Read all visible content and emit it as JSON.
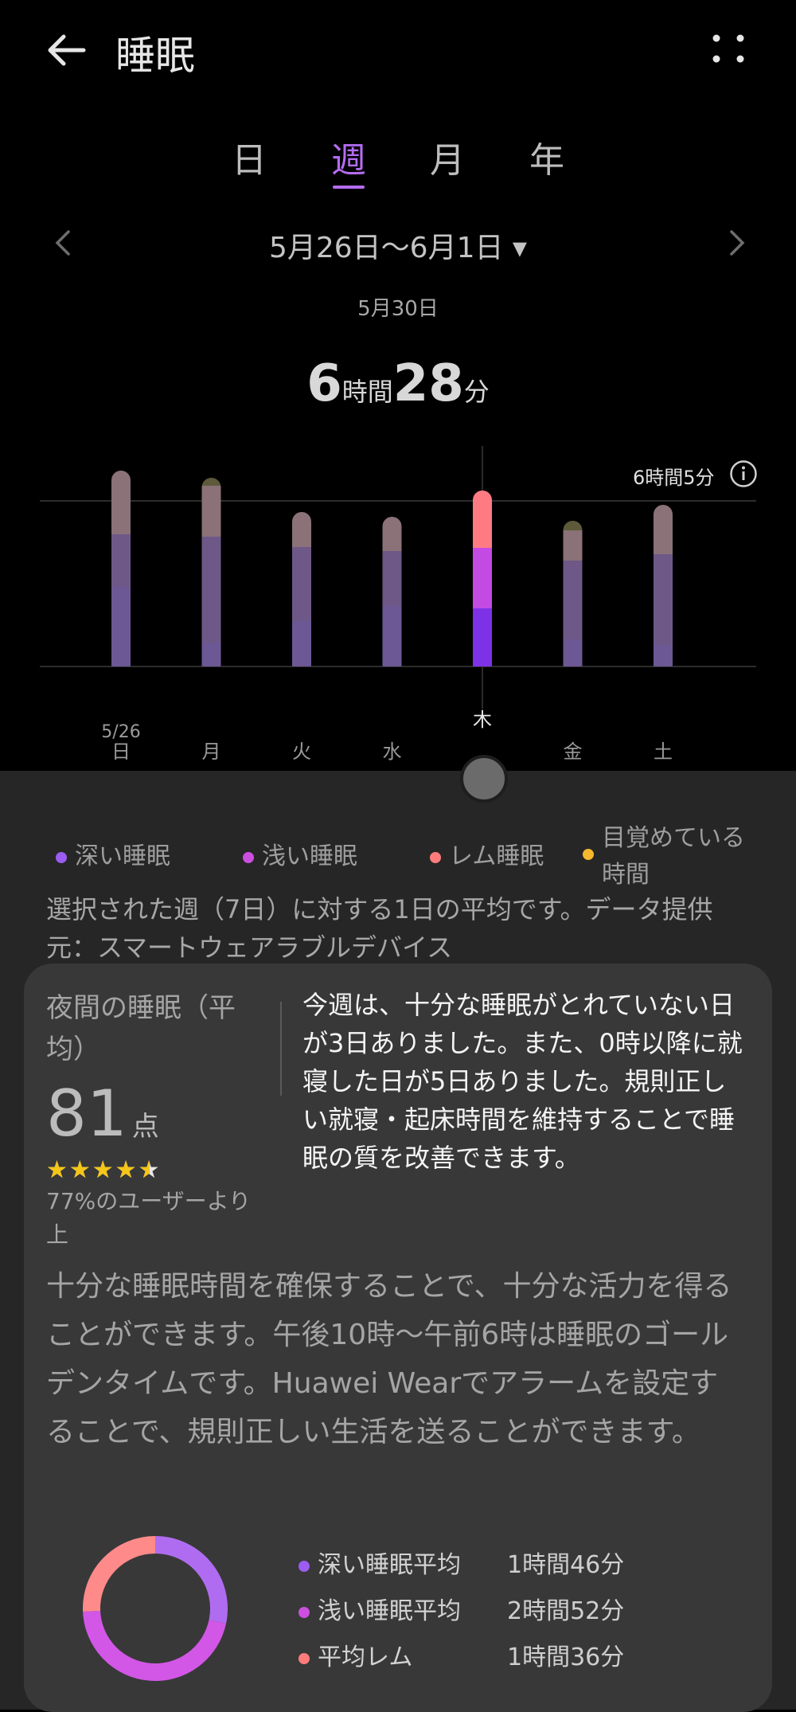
{
  "header": {
    "title": "睡眠"
  },
  "tabs": [
    {
      "label": "日",
      "active": false
    },
    {
      "label": "週",
      "active": true
    },
    {
      "label": "月",
      "active": false
    },
    {
      "label": "年",
      "active": false
    }
  ],
  "range": {
    "label": "5月26日〜6月1日 ▾"
  },
  "selected_date": "5月30日",
  "duration": {
    "hours": "6",
    "hours_unit": "時間",
    "minutes": "28",
    "minutes_unit": "分"
  },
  "average_label": "6時間5分",
  "chart_data": {
    "type": "bar",
    "stacked": true,
    "categories": [
      "日",
      "月",
      "火",
      "水",
      "木",
      "金",
      "土"
    ],
    "first_date_label": "5/26",
    "selected_category": "木",
    "series": [
      {
        "name": "深い睡眠",
        "color": "#7d32e8",
        "values": [
          100,
          30,
          57,
          76,
          73,
          34,
          27
        ]
      },
      {
        "name": "浅い睡眠",
        "color": "#c44ae4",
        "values": [
          66,
          133,
          93,
          69,
          76,
          99,
          114
        ]
      },
      {
        "name": "レム睡眠",
        "color": "#ff7b84",
        "values": [
          80,
          64,
          44,
          43,
          72,
          38,
          62
        ]
      },
      {
        "name": "目覚めている時間",
        "color": "#f5c542",
        "values": [
          0,
          10,
          0,
          0,
          0,
          12,
          0
        ]
      }
    ],
    "average_line": 208,
    "ylim": [
      0,
      260
    ],
    "grid": true
  },
  "legend": [
    {
      "label": "深い睡眠",
      "color": "#9b5cf0"
    },
    {
      "label": "浅い睡眠",
      "color": "#cc4fe0"
    },
    {
      "label": "レム睡眠",
      "color": "#ff7c7c"
    },
    {
      "label": "目覚めている時間",
      "color": "#f5b82e"
    }
  ],
  "description": "選択された週（7日）に対する1日の平均です。データ提供元：スマートウェアラブルデバイス",
  "card": {
    "title": "夜間の睡眠（平均）",
    "score": "81",
    "score_unit": "点",
    "stars": "★★★★★",
    "rating": 4.5,
    "percent": "77%のユーザーより上",
    "advice": "今週は、十分な睡眠がとれていない日が3日ありました。また、0時以降に就寝した日が5日ありました。規則正しい就寝・起床時間を維持することで睡眠の質を改善できます。",
    "tip": "十分な睡眠時間を確保することで、十分な活力を得ることができます。午後10時〜午前6時は睡眠のゴールデンタイムです。Huawei Wearでアラームを設定することで、規則正しい生活を送ることができます。"
  },
  "stats": [
    {
      "label": "深い睡眠平均",
      "value": "1時間46分",
      "color": "#9b5cf0"
    },
    {
      "label": "浅い睡眠平均",
      "value": "2時間52分",
      "color": "#cc4fe0"
    },
    {
      "label": "平均レム",
      "value": "1時間36分",
      "color": "#ff7c7c"
    }
  ],
  "donut_data": {
    "type": "pie",
    "slices": [
      {
        "name": "深い睡眠平均",
        "minutes": 106,
        "color": "#b06cf0"
      },
      {
        "name": "浅い睡眠平均",
        "minutes": 172,
        "color": "#d257e6"
      },
      {
        "name": "平均レム",
        "minutes": 96,
        "color": "#ff8a8a"
      }
    ]
  }
}
